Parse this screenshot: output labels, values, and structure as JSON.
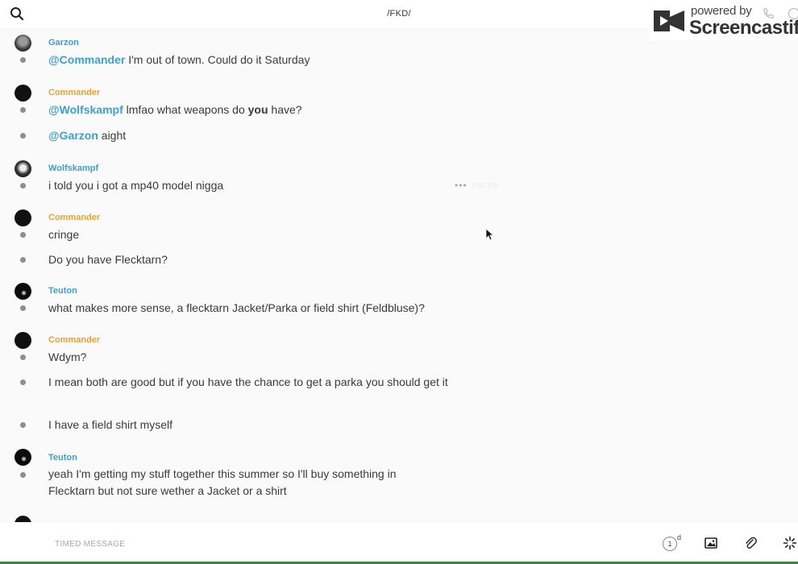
{
  "header": {
    "channel_title": "/FKD/",
    "search_icon": "search-icon"
  },
  "watermark": {
    "top_text": "powered by",
    "brand": "Screencastify",
    "icons": [
      "screencastify-logo-icon",
      "phone-icon",
      "info-icon"
    ]
  },
  "messages": [
    {
      "user": "Garzon",
      "user_color": "#3f9ed6",
      "items": [
        {
          "mention": "@Commander",
          "text": " I'm out of town. Could do it Saturday"
        }
      ]
    },
    {
      "user": "Commander",
      "user_color": "#f0a030",
      "items": [
        {
          "mention": "@Wolfskampf",
          "text_before": " lmfao what weapons do ",
          "bold": "you",
          "text_after": " have?"
        },
        {
          "mention": "@Garzon",
          "text": " aight"
        }
      ]
    },
    {
      "user": "Wolfskampf",
      "user_color": "#3f9ed6",
      "items": [
        {
          "text": "i told you i got a mp40 model nigga",
          "hover_dots": "•••",
          "hover_time": "2:46 PM"
        }
      ]
    },
    {
      "user": "Commander",
      "user_color": "#f0a030",
      "items": [
        {
          "text": "cringe"
        },
        {
          "text": "Do you have Flecktarn?"
        }
      ]
    },
    {
      "user": "Teuton",
      "user_color": "#3f9ed6",
      "items": [
        {
          "text": "what makes more sense, a flecktarn Jacket/Parka  or field shirt (Feldbluse)?"
        }
      ]
    },
    {
      "user": "Commander",
      "user_color": "#f0a030",
      "items": [
        {
          "text": "Wdym?"
        },
        {
          "text": "I mean both are good but if you have the chance to get a parka you should get it"
        },
        {
          "text": "I have a field shirt myself"
        }
      ]
    },
    {
      "user": "Teuton",
      "user_color": "#3f9ed6",
      "items": [
        {
          "text": "yeah I'm getting my stuff together this summer so I'll buy something in Flecktarn but not sure wether a Jacket or a shirt"
        }
      ]
    }
  ],
  "composer": {
    "placeholder": "TIMED MESSAGE",
    "timer_value": "1",
    "timer_unit": "d",
    "icons": [
      "image-icon",
      "paperclip-icon",
      "sparkle-icon"
    ]
  },
  "colors": {
    "mention": "#3f9ed6",
    "username_blue": "#3f9ed6",
    "username_orange": "#f0a030",
    "bottom_accent": "#2f8a3e"
  }
}
